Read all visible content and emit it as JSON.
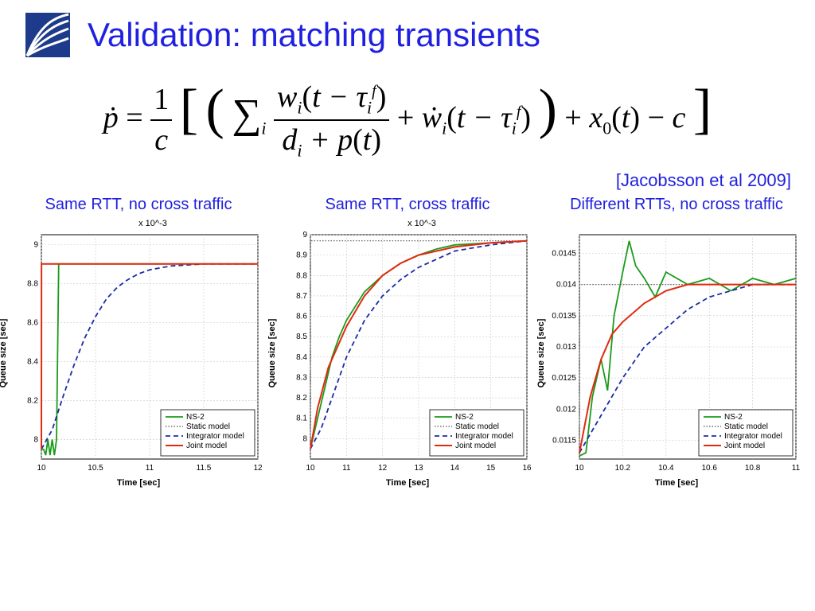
{
  "title": "Validation: matching transients",
  "citation": "[Jacobsson et al 2009]",
  "equation_plain": "p_dot = (1/c) * [ ( sum_i  w_i(t - tau_i^f) / (d_i + p(t))  +  w_dot_i(t - tau_i^f) )  +  x_0(t)  -  c ]",
  "axis_labels": {
    "x": "Time [sec]",
    "y": "Queue size [sec]"
  },
  "y_exponent_label": "x 10^-3",
  "legend": [
    "NS-2",
    "Static model",
    "Integrator model",
    "Joint model"
  ],
  "chart_data": [
    {
      "type": "line",
      "caption": "Same RTT, no cross traffic",
      "xlabel": "Time [sec]",
      "ylabel": "Queue size [sec]",
      "xlim": [
        10,
        12
      ],
      "ylim": [
        0.0079,
        0.00905
      ],
      "xticks": [
        10,
        10.5,
        11,
        11.5,
        12
      ],
      "yticks_e3": [
        8,
        8.2,
        8.4,
        8.6,
        8.8,
        9
      ],
      "series": [
        {
          "name": "NS-2",
          "x": [
            10,
            10.02,
            10.04,
            10.06,
            10.08,
            10.1,
            10.12,
            10.14,
            10.16,
            10.2,
            10.25,
            10.3,
            10.35,
            10.4,
            10.45,
            10.5,
            11,
            11.5,
            12
          ],
          "y_e3": [
            7.95,
            7.95,
            7.92,
            8.0,
            7.92,
            8.0,
            7.92,
            8.0,
            8.9,
            8.9,
            8.9,
            8.9,
            8.9,
            8.9,
            8.9,
            8.9,
            8.9,
            8.9,
            8.9
          ],
          "style": "ns2"
        },
        {
          "name": "Static model",
          "x": [
            10,
            10.001,
            10.14,
            12
          ],
          "y_e3": [
            7.95,
            8.9,
            8.9,
            8.9
          ],
          "style": "staticm"
        },
        {
          "name": "Integrator model",
          "x": [
            10,
            10.1,
            10.2,
            10.3,
            10.4,
            10.5,
            10.6,
            10.7,
            10.8,
            10.9,
            11,
            11.2,
            11.5,
            12
          ],
          "y_e3": [
            7.95,
            8.05,
            8.22,
            8.38,
            8.52,
            8.63,
            8.72,
            8.78,
            8.82,
            8.85,
            8.87,
            8.89,
            8.9,
            8.9
          ],
          "style": "integ"
        },
        {
          "name": "Joint model",
          "x": [
            10,
            10.001,
            10.14,
            12
          ],
          "y_e3": [
            7.95,
            8.9,
            8.9,
            8.9
          ],
          "style": "joint"
        }
      ]
    },
    {
      "type": "line",
      "caption": "Same RTT, cross traffic",
      "xlabel": "Time [sec]",
      "ylabel": "Queue size [sec]",
      "xlim": [
        10,
        16
      ],
      "ylim": [
        0.0079,
        0.009
      ],
      "xticks": [
        10,
        11,
        12,
        13,
        14,
        15,
        16
      ],
      "yticks_e3": [
        8,
        8.1,
        8.2,
        8.3,
        8.4,
        8.5,
        8.6,
        8.7,
        8.8,
        8.9,
        9
      ],
      "series": [
        {
          "name": "NS-2",
          "x": [
            10,
            10.2,
            10.4,
            10.6,
            10.8,
            11,
            11.5,
            12,
            12.5,
            13,
            13.5,
            14,
            15,
            16
          ],
          "y_e3": [
            7.95,
            8.1,
            8.25,
            8.4,
            8.5,
            8.58,
            8.72,
            8.8,
            8.86,
            8.9,
            8.93,
            8.95,
            8.96,
            8.97
          ],
          "style": "ns2"
        },
        {
          "name": "Static model",
          "x": [
            10,
            10.001,
            16
          ],
          "y_e3": [
            7.95,
            8.97,
            8.97
          ],
          "style": "staticm"
        },
        {
          "name": "Integrator model",
          "x": [
            10,
            10.3,
            10.6,
            11,
            11.5,
            12,
            12.5,
            13,
            14,
            15,
            16
          ],
          "y_e3": [
            7.95,
            8.05,
            8.2,
            8.4,
            8.58,
            8.7,
            8.78,
            8.84,
            8.92,
            8.95,
            8.97
          ],
          "style": "integ"
        },
        {
          "name": "Joint model",
          "x": [
            10,
            10.2,
            10.5,
            11,
            11.5,
            12,
            12.5,
            13,
            14,
            15,
            16
          ],
          "y_e3": [
            7.95,
            8.15,
            8.35,
            8.55,
            8.7,
            8.8,
            8.86,
            8.9,
            8.94,
            8.96,
            8.97
          ],
          "style": "joint"
        }
      ]
    },
    {
      "type": "line",
      "caption": "Different RTTs, no cross traffic",
      "xlabel": "Time [sec]",
      "ylabel": "Queue size [sec]",
      "xlim": [
        10,
        11
      ],
      "ylim": [
        0.0112,
        0.0148
      ],
      "xticks": [
        10,
        10.2,
        10.4,
        10.6,
        10.8,
        11
      ],
      "yticks": [
        0.0115,
        0.012,
        0.0125,
        0.013,
        0.0135,
        0.014,
        0.0145
      ],
      "series": [
        {
          "name": "NS-2",
          "x": [
            10,
            10.03,
            10.06,
            10.1,
            10.13,
            10.16,
            10.2,
            10.23,
            10.26,
            10.3,
            10.35,
            10.4,
            10.5,
            10.6,
            10.7,
            10.8,
            10.9,
            11
          ],
          "y": [
            0.01125,
            0.0113,
            0.0122,
            0.0128,
            0.0123,
            0.0135,
            0.0142,
            0.0147,
            0.0143,
            0.0141,
            0.0138,
            0.0142,
            0.014,
            0.0141,
            0.0139,
            0.0141,
            0.014,
            0.0141
          ],
          "style": "ns2"
        },
        {
          "name": "Static model",
          "x": [
            10,
            10.001,
            10.06,
            11
          ],
          "y": [
            0.0113,
            0.014,
            0.014,
            0.014
          ],
          "style": "staticm"
        },
        {
          "name": "Integrator model",
          "x": [
            10,
            10.1,
            10.2,
            10.3,
            10.4,
            10.5,
            10.6,
            10.7,
            10.8,
            11
          ],
          "y": [
            0.0113,
            0.0119,
            0.0125,
            0.013,
            0.0133,
            0.0136,
            0.0138,
            0.0139,
            0.014,
            0.014
          ],
          "style": "integ"
        },
        {
          "name": "Joint model",
          "x": [
            10,
            10.05,
            10.1,
            10.15,
            10.2,
            10.3,
            10.4,
            10.5,
            10.7,
            11
          ],
          "y": [
            0.0113,
            0.0122,
            0.0128,
            0.0132,
            0.0134,
            0.0137,
            0.0139,
            0.014,
            0.014,
            0.014
          ],
          "style": "joint"
        }
      ]
    }
  ]
}
